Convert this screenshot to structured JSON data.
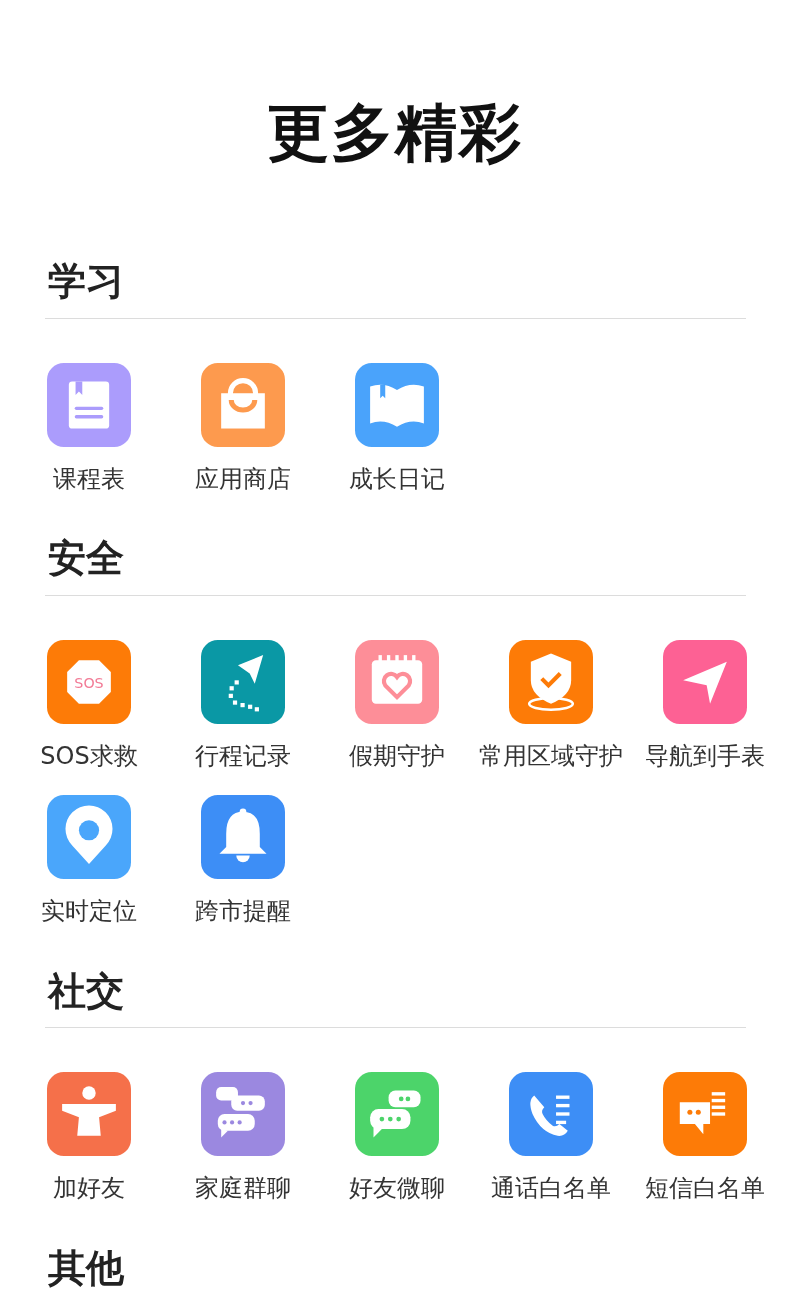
{
  "title": "更多精彩",
  "sections": [
    {
      "heading": "学习",
      "items": [
        {
          "label": "课程表",
          "kind": "book",
          "color": "#ab9cfc"
        },
        {
          "label": "应用商店",
          "kind": "bag",
          "color": "#fd9a4e"
        },
        {
          "label": "成长日记",
          "kind": "openbook",
          "color": "#4aa3fb"
        }
      ]
    },
    {
      "heading": "安全",
      "items": [
        {
          "label": "SOS求救",
          "kind": "sos",
          "color": "#fd7b07",
          "icon_text": "SOS"
        },
        {
          "label": "行程记录",
          "kind": "route",
          "color": "#0a98a5"
        },
        {
          "label": "假期守护",
          "kind": "calendar",
          "color": "#fd8e98"
        },
        {
          "label": "常用区域守护",
          "kind": "shield",
          "color": "#fd7b07"
        },
        {
          "label": "导航到手表",
          "kind": "navigate",
          "color": "#fd6194"
        },
        {
          "label": "实时定位",
          "kind": "pin",
          "color": "#4aa6fb"
        },
        {
          "label": "跨市提醒",
          "kind": "bell",
          "color": "#3d8ef6"
        }
      ]
    },
    {
      "heading": "社交",
      "items": [
        {
          "label": "加好友",
          "kind": "person",
          "color": "#f5704a"
        },
        {
          "label": "家庭群聊",
          "kind": "chats",
          "color": "#9b88e0"
        },
        {
          "label": "好友微聊",
          "kind": "chat2",
          "color": "#4cd46a"
        },
        {
          "label": "通话白名单",
          "kind": "phone",
          "color": "#3d8ef6"
        },
        {
          "label": "短信白名单",
          "kind": "sms",
          "color": "#fd7b07"
        }
      ]
    },
    {
      "heading": "其他"
    }
  ]
}
